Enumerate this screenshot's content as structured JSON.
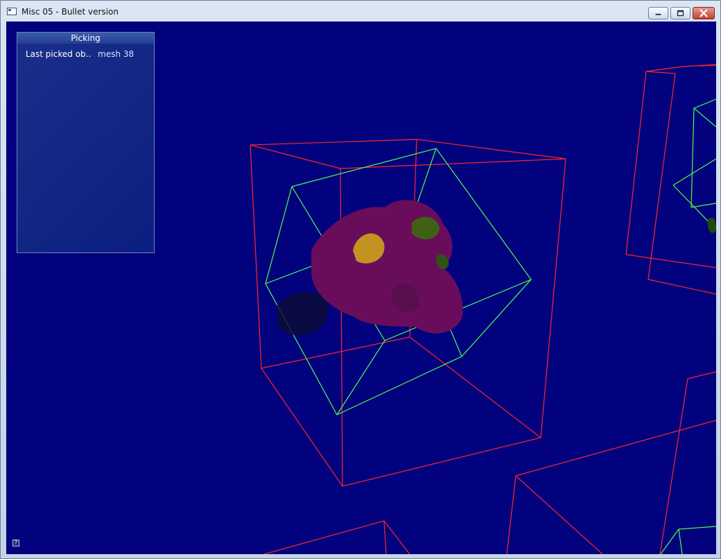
{
  "window": {
    "title": "Misc 05 - Bullet version",
    "icon": "app-window-icon",
    "controls": [
      "minimize-icon",
      "maximize-icon",
      "close-icon"
    ]
  },
  "viewport": {
    "background_color": "#02027e",
    "panel": {
      "title": "Picking",
      "rows": [
        {
          "label": "Last picked ob..",
          "value": "mesh 38"
        }
      ]
    },
    "help_button": {
      "label": "?"
    }
  },
  "colors": {
    "bounding_box_outer": "#ff2626",
    "bounding_box_inner": "#4cff4c",
    "mesh_body": "#6a0c5c"
  }
}
